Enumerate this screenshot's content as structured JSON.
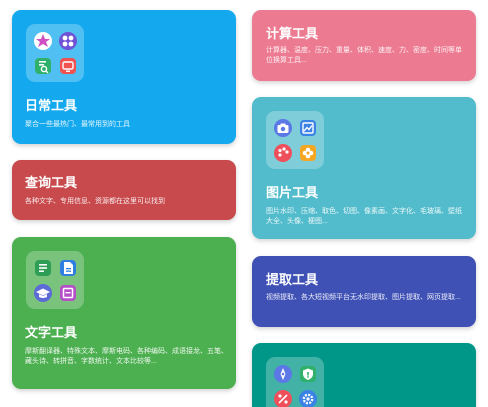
{
  "colors": {
    "daily": "#14a9ee",
    "query": "#c84a4d",
    "text": "#4caf50",
    "calc": "#ec7b92",
    "image": "#52bccc",
    "extract": "#3f51b5",
    "teal": "#009688"
  },
  "cards": {
    "daily": {
      "title": "日常工具",
      "desc": "聚合一些最热门、最常用到的工具",
      "icons": [
        "sticker-icon",
        "apps-grid-icon",
        "document-search-icon",
        "tv-icon"
      ]
    },
    "query": {
      "title": "查询工具",
      "desc": "各种文字、专用信息、资源都在这里可以找到"
    },
    "text": {
      "title": "文字工具",
      "desc": "摩斯翻译器、特殊文本、摩斯电码、各种编码、成语接龙、五笔、藏头诗、转拼音、字数统计、文本比较等...",
      "icons": [
        "text-document-icon",
        "note-icon",
        "graduation-cap-icon",
        "page-frame-icon"
      ]
    },
    "calc": {
      "title": "计算工具",
      "desc": "计算器、温度、压力、重量、体积、速度、力、密度、时间等单位换算工具..."
    },
    "image": {
      "title": "图片工具",
      "desc": "图片水印、压缩、取色、切图、像素画、文字化、毛玻璃、壁纸大全、头像、梗图...",
      "icons": [
        "camera-icon",
        "image-chart-icon",
        "palette-icon",
        "flower-icon"
      ]
    },
    "extract": {
      "title": "提取工具",
      "desc": "视频提取、各大短视频平台无水印提取、图片提取、网页提取..."
    },
    "teal": {
      "icons": [
        "compass-icon",
        "shield-icon",
        "percent-icon",
        "gear-icon"
      ]
    }
  }
}
